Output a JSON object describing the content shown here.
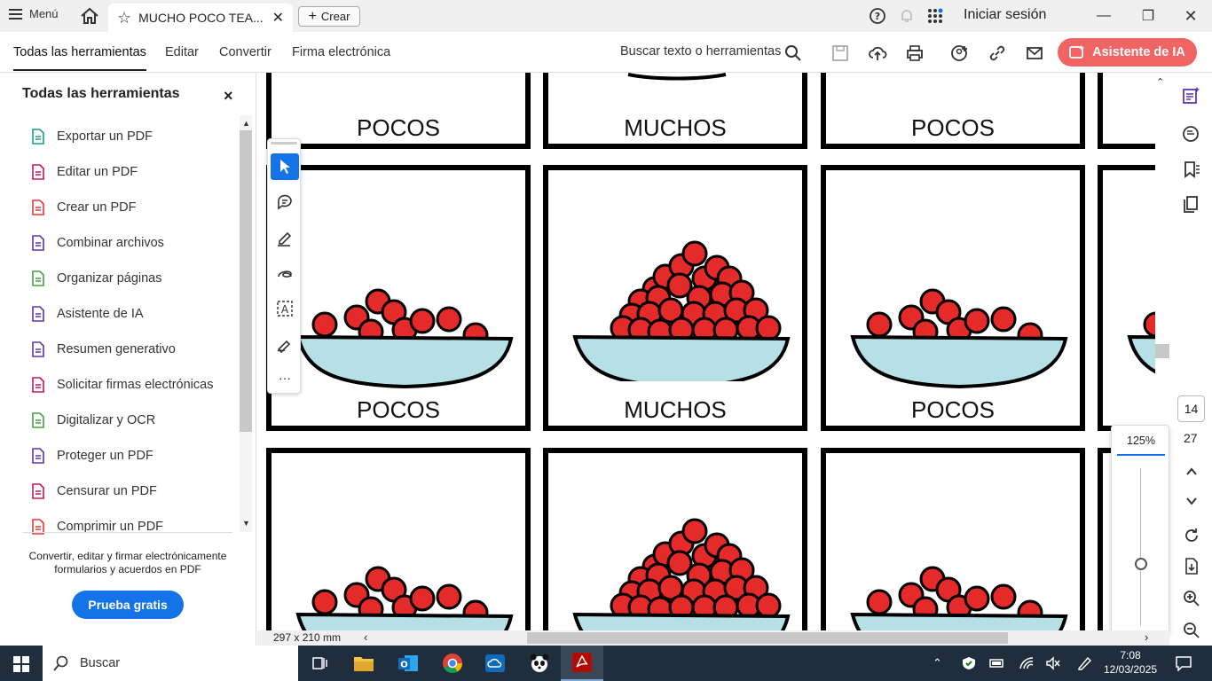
{
  "titlebar": {
    "menu_label": "Menú",
    "tab_title": "MUCHO POCO TEA...",
    "create_label": "Crear",
    "signin_label": "Iniciar sesión"
  },
  "menubar": {
    "tabs": [
      "Todas las herramientas",
      "Editar",
      "Convertir",
      "Firma electrónica"
    ],
    "search_label": "Buscar texto o herramientas",
    "ai_label": "Asistente de IA"
  },
  "leftpanel": {
    "title": "Todas las herramientas",
    "tools": [
      {
        "label": "Exportar un PDF",
        "color": "#1a9c8c"
      },
      {
        "label": "Editar un PDF",
        "color": "#c2185b"
      },
      {
        "label": "Crear un PDF",
        "color": "#e53935"
      },
      {
        "label": "Combinar archivos",
        "color": "#5e35b1"
      },
      {
        "label": "Organizar páginas",
        "color": "#43a047"
      },
      {
        "label": "Asistente de IA",
        "color": "#5e35b1"
      },
      {
        "label": "Resumen generativo",
        "color": "#5e35b1"
      },
      {
        "label": "Solicitar firmas electrónicas",
        "color": "#c2185b"
      },
      {
        "label": "Digitalizar y OCR",
        "color": "#43a047"
      },
      {
        "label": "Proteger un PDF",
        "color": "#5e35b1"
      },
      {
        "label": "Censurar un PDF",
        "color": "#c2185b"
      },
      {
        "label": "Comprimir un PDF",
        "color": "#e53935"
      }
    ],
    "promo_text": "Convertir, editar y firmar electrónicamente formularios y acuerdos en PDF",
    "trial_label": "Prueba gratis"
  },
  "document": {
    "cards": [
      "POCOS",
      "MUCHOS",
      "POCOS",
      "POCOS",
      "MUCHOS",
      "POCOS",
      "",
      "",
      ""
    ]
  },
  "pagenav": {
    "current": "14",
    "total": "27"
  },
  "zoom": {
    "value": "125%"
  },
  "bottombar": {
    "page_size": "297 x 210 mm"
  },
  "taskbar": {
    "search_label": "Buscar",
    "time": "7:08",
    "date": "12/03/2025"
  }
}
